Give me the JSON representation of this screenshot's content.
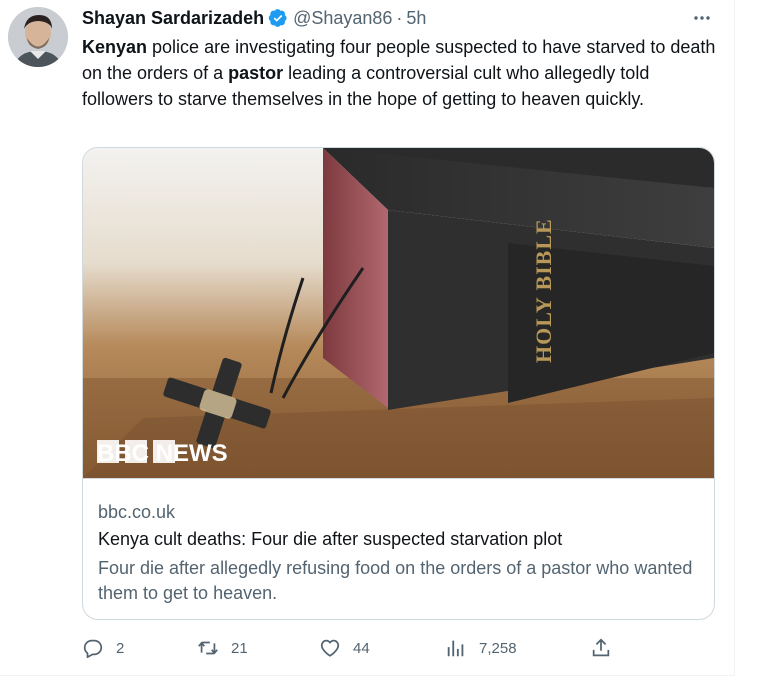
{
  "tweet": {
    "author_name": "Shayan Sardarizadeh",
    "handle": "@Shayan86",
    "separator": "·",
    "time": "5h",
    "text_parts": [
      {
        "t": "Kenyan",
        "bold": true
      },
      {
        "t": " police are investigating four people suspected to have starved to death on the orders of a ",
        "bold": false
      },
      {
        "t": "pastor",
        "bold": true
      },
      {
        "t": " leading a controversial cult who allegedly told followers to starve themselves in the hope of getting to heaven quickly.",
        "bold": false
      }
    ]
  },
  "card": {
    "image_brand": "BBC NEWS",
    "book_spine_text": "HOLY BIBLE",
    "domain": "bbc.co.uk",
    "title": "Kenya cult deaths: Four die after suspected starvation plot",
    "description": "Four die after allegedly refusing food on the orders of a pastor who wanted them to get to heaven."
  },
  "actions": {
    "replies": "2",
    "retweets": "21",
    "likes": "44",
    "views": "7,258"
  },
  "icons": {
    "verified": "verified-badge-icon",
    "more": "more-icon",
    "reply": "reply-icon",
    "retweet": "retweet-icon",
    "like": "like-icon",
    "views": "views-icon",
    "share": "share-icon"
  },
  "colors": {
    "verified_blue": "#1d9bf0",
    "secondary_text": "#536471",
    "primary_text": "#0f1419",
    "border": "#cfd9de"
  }
}
